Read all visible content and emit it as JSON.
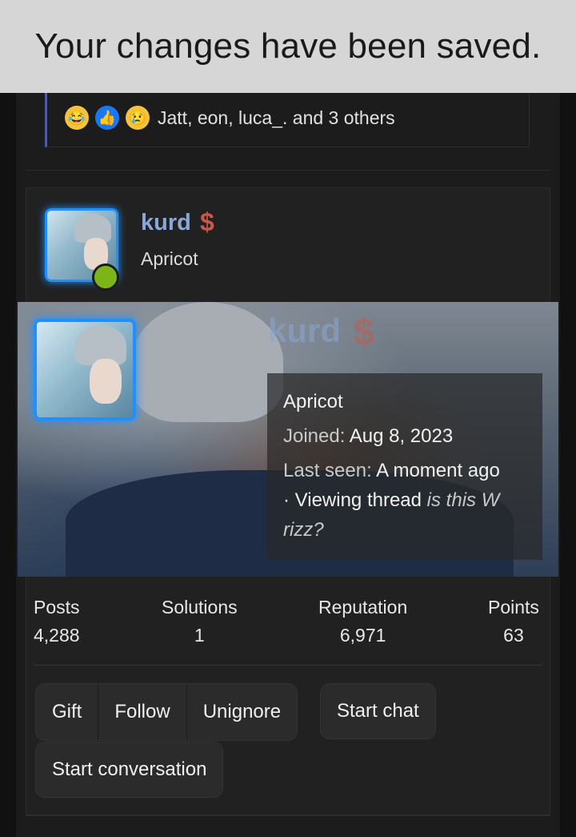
{
  "toast": {
    "message": "Your changes have been saved."
  },
  "reactions": {
    "emojis": [
      "laugh-emoji",
      "like-emoji",
      "sad-emoji"
    ],
    "text": "Jatt, eon, luca_. and 3 others"
  },
  "member": {
    "username": "kurd",
    "badge_icon": "dollar-icon",
    "rank": "Apricot",
    "status": "online"
  },
  "banner": {
    "username": "kurd",
    "rank": "Apricot",
    "joined_label": "Joined:",
    "joined_value": "Aug 8, 2023",
    "last_seen_label": "Last seen:",
    "last_seen_value": "A moment ago",
    "activity_prefix": "· Viewing thread",
    "thread_title_part1": "is this W",
    "thread_title_part2": "rizz?"
  },
  "stats": [
    {
      "label": "Posts",
      "value": "4,288"
    },
    {
      "label": "Solutions",
      "value": "1"
    },
    {
      "label": "Reputation",
      "value": "6,971"
    },
    {
      "label": "Points",
      "value": "63"
    }
  ],
  "actions": {
    "gift": "Gift",
    "follow": "Follow",
    "unignore": "Unignore",
    "start_chat": "Start chat",
    "start_conversation": "Start conversation"
  },
  "colors": {
    "accent_blue": "#1e90ff",
    "username_color": "#8aa6d6",
    "online_green": "#7cb518",
    "toast_bg": "#d6d6d6"
  }
}
